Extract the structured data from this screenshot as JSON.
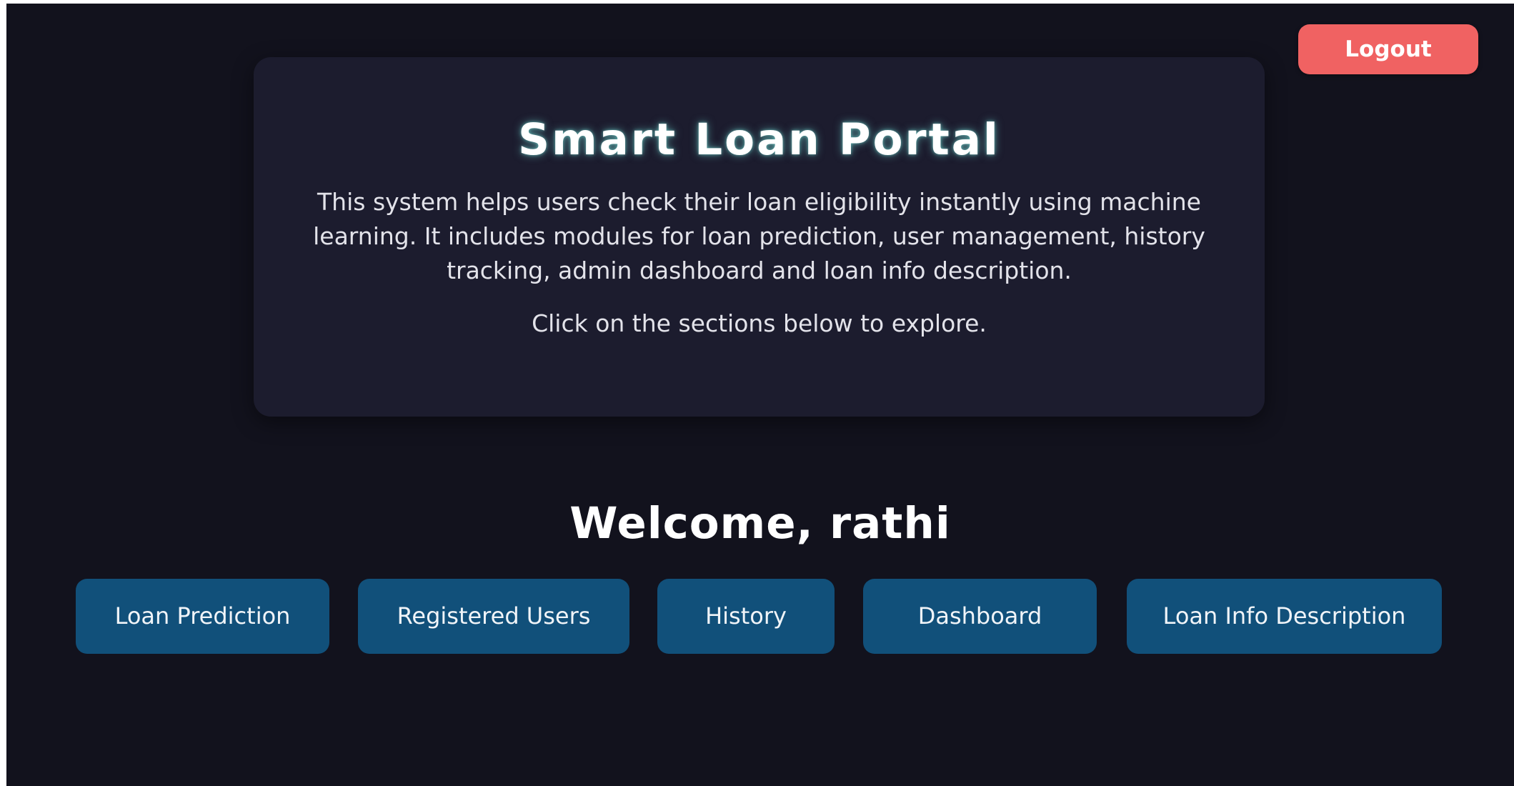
{
  "header": {
    "logout_label": "Logout"
  },
  "info_card": {
    "title": "Smart Loan Portal",
    "description": "This system helps users check their loan eligibility instantly using machine learning. It includes modules for loan prediction, user management, history tracking, admin dashboard and loan info description.",
    "hint": "Click on the sections below to explore."
  },
  "welcome": {
    "text": "Welcome, rathi"
  },
  "nav": {
    "loan_prediction": "Loan Prediction",
    "registered_users": "Registered Users",
    "history": "History",
    "dashboard": "Dashboard",
    "loan_info_description": "Loan Info Description"
  },
  "colors": {
    "background": "#12121d",
    "card": "#1c1c2e",
    "logout": "#f06262",
    "nav_button": "#11507a"
  }
}
